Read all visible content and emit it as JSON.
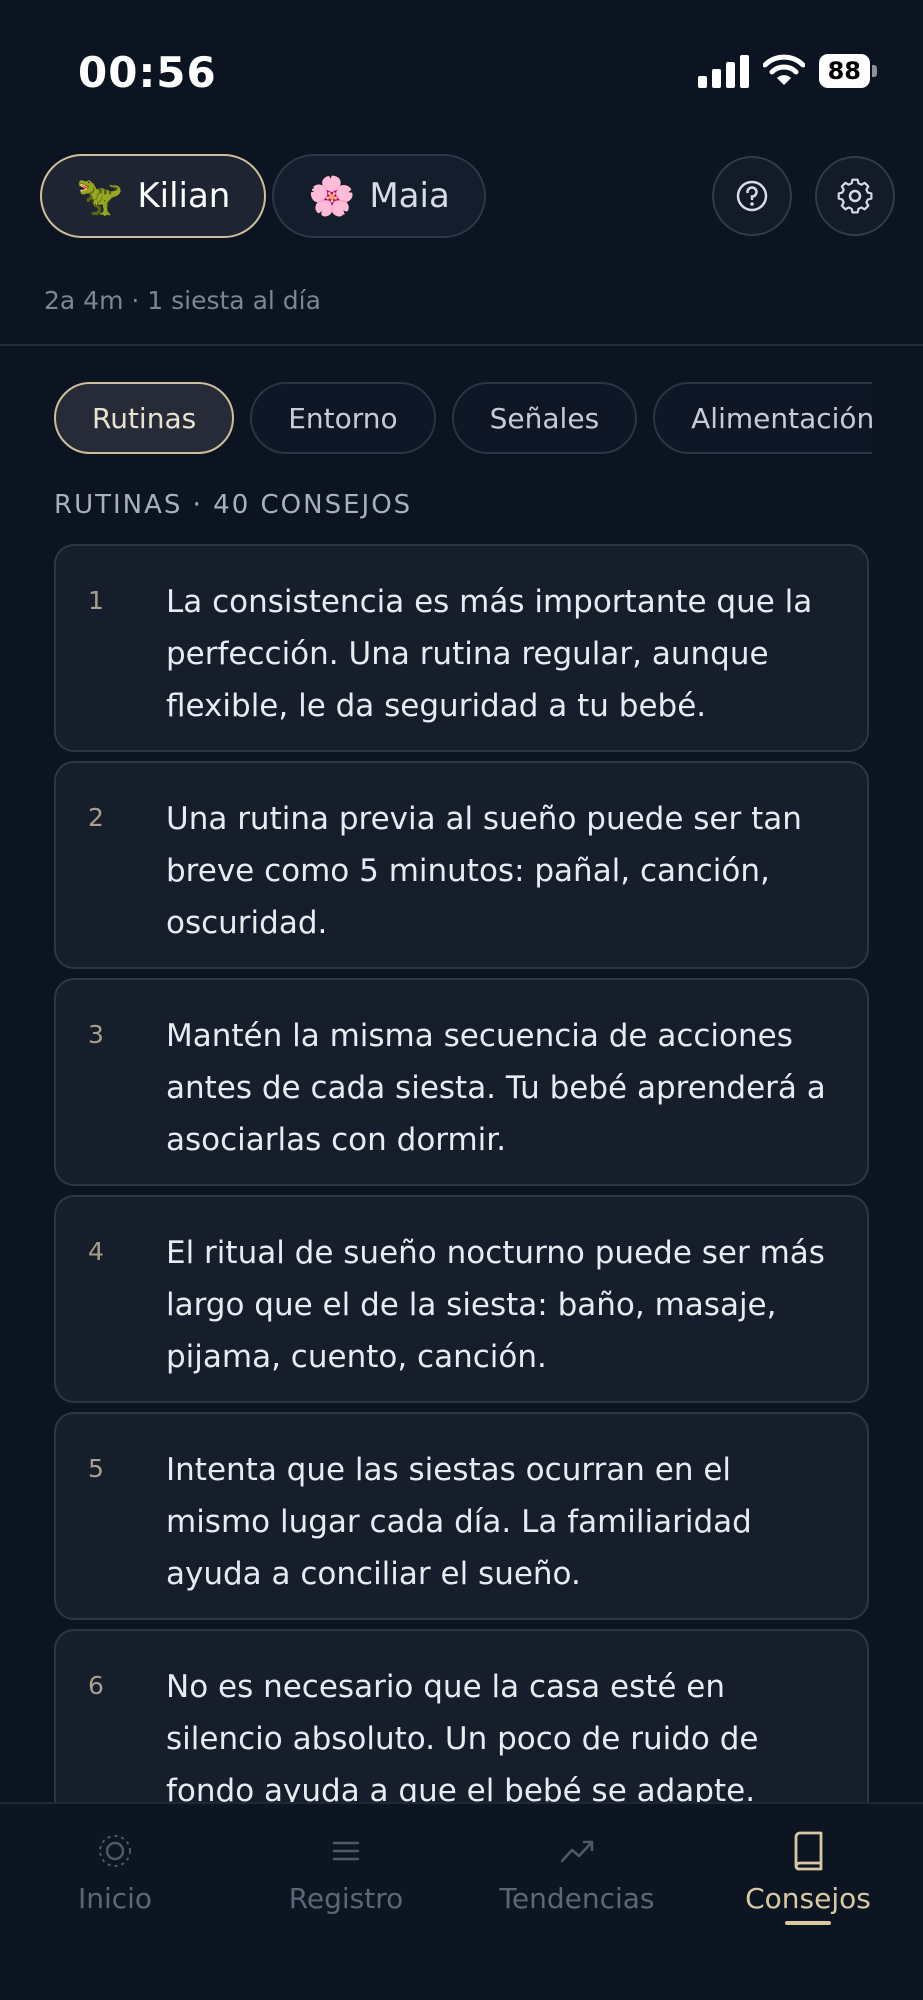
{
  "status": {
    "time": "00:56",
    "battery": "88"
  },
  "header": {
    "children": [
      {
        "emoji": "🦖",
        "name": "Kilian",
        "active": true
      },
      {
        "emoji": "🌸",
        "name": "Maia",
        "active": false
      }
    ],
    "help_icon": "question-circle-icon",
    "settings_icon": "gear-icon"
  },
  "subtitle": "2a 4m · 1 siesta al día",
  "tabs": [
    {
      "label": "Rutinas",
      "active": true
    },
    {
      "label": "Entorno",
      "active": false
    },
    {
      "label": "Señales",
      "active": false
    },
    {
      "label": "Alimentación",
      "active": false
    }
  ],
  "section_label": "RUTINAS · 40 CONSEJOS",
  "tips": [
    {
      "number": "1",
      "text": "La consistencia es más importante que la perfección. Una rutina regular, aunque flexible, le da seguridad a tu bebé."
    },
    {
      "number": "2",
      "text": "Una rutina previa al sueño puede ser tan breve como 5 minutos: pañal, canción, oscuridad."
    },
    {
      "number": "3",
      "text": "Mantén la misma secuencia de acciones antes de cada siesta. Tu bebé aprenderá a asociarlas con dormir."
    },
    {
      "number": "4",
      "text": "El ritual de sueño nocturno puede ser más largo que el de la siesta: baño, masaje, pijama, cuento, canción."
    },
    {
      "number": "5",
      "text": "Intenta que las siestas ocurran en el mismo lugar cada día. La familiaridad ayuda a conciliar el sueño."
    },
    {
      "number": "6",
      "text": "No es necesario que la casa esté en silencio absoluto. Un poco de ruido de fondo ayuda a que el bebé se adapte."
    }
  ],
  "nav": [
    {
      "label": "Inicio",
      "icon": "sun-icon",
      "active": false
    },
    {
      "label": "Registro",
      "icon": "list-icon",
      "active": false
    },
    {
      "label": "Tendencias",
      "icon": "trend-up-icon",
      "active": false
    },
    {
      "label": "Consejos",
      "icon": "book-icon",
      "active": true
    }
  ],
  "colors": {
    "accent": "#d8c9a3",
    "background": "#0c1422",
    "card": "#161e2c"
  }
}
